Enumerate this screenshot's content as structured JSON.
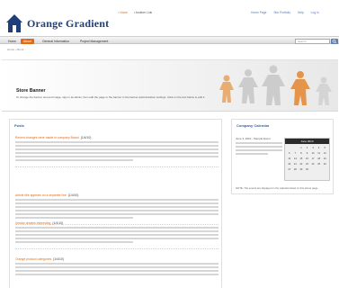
{
  "header": {
    "brand": "Orange Gradient",
    "center_links": [
      "• Home",
      "• Another Link"
    ],
    "right_links": [
      "Home Page",
      "Site Portfolio",
      "Help",
      "Log In"
    ]
  },
  "nav": {
    "items": [
      "Home",
      "About",
      "General Information",
      "Project Management"
    ],
    "active_index": 1,
    "search_placeholder": "Search"
  },
  "breadcrumb": "Home  ›  About",
  "banner": {
    "title": "Store Banner",
    "subtitle": "To change the banner text and image, sign in as admin, then edit the page or the banner in the banner administration settings. Click on the text below to edit it."
  },
  "main": {
    "heading": "Posts",
    "posts": [
      {
        "title": "Recent changes were made to company Brand",
        "count": "(1/4/10)"
      },
      {
        "title": "Article title appears on a separate line",
        "count": "(1/4/10)"
      },
      {
        "title": "Vendor creates interesting",
        "count": "(1/4/10)"
      },
      {
        "title": "Orange product categories",
        "count": "(1/4/10)"
      }
    ]
  },
  "sidebar": {
    "heading": "Company Calendar",
    "date": "June 3, 2010 - Sample Event",
    "calendar": {
      "month": "June 2010",
      "days": [
        "",
        "",
        "1",
        "2",
        "3",
        "4",
        "5",
        "6",
        "7",
        "8",
        "9",
        "10",
        "11",
        "12",
        "13",
        "14",
        "15",
        "16",
        "17",
        "18",
        "19",
        "20",
        "21",
        "22",
        "23",
        "24",
        "25",
        "26",
        "27",
        "28",
        "29",
        "30",
        "",
        "",
        ""
      ]
    },
    "note": "NOTE: The events are displayed in the calendar listed on this Home page."
  },
  "colors": {
    "accent": "#e46a12",
    "brand_blue": "#1f3f7a",
    "link_blue": "#3a5f9e"
  }
}
